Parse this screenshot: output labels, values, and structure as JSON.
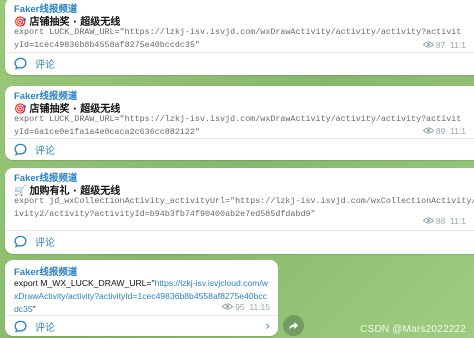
{
  "posts": [
    {
      "channel": "Faker线报频道",
      "emoji": "🎯",
      "title": "店铺抽奖 · 超级无线",
      "body": "export LUCK_DRAW_URL=\"https://lzkj-isv.isvjd.com/wxDrawActivity/activity/activity?activityId=1cec49836b8b4558af8275e40bccdc35\"",
      "views": "87",
      "time": "11:1",
      "comment_label": "评论"
    },
    {
      "channel": "Faker线报频道",
      "emoji": "🎯",
      "title": "店铺抽奖 · 超级无线",
      "body": "export LUCK_DRAW_URL=\"https://lzkj-isv.isvjd.com/wxDrawActivity/activity/activity?activityId=6a1ce0e1fa1a4e0caca2c636cc882122\"",
      "views": "89",
      "time": "11:1",
      "comment_label": "评论"
    },
    {
      "channel": "Faker线报频道",
      "emoji": "🛒",
      "title": "加购有礼 · 超级无线",
      "body": "export jd_wxCollectionActivity_activityUrl=\"https://lzkj-isv.isvjd.com/wxCollectionActivity/activity2/activity?activityId=b94b3fb74f90400ab2e7ed585dfdabd9\"",
      "views": "88",
      "time": "11:1",
      "comment_label": "评论"
    },
    {
      "channel": "Faker线报频道",
      "prefix": "export M_WX_LUCK_DRAW_URL=\"",
      "link": "https://lzkj-isv.isvjcloud.com/wxDrawActivity/activity?activityId=1cec49836b8b4558af8275e40bccdc35",
      "suffix": "\"",
      "views": "95",
      "time": "11:15",
      "comment_label": "评论"
    }
  ],
  "watermark": "CSDN @Mars2022222",
  "icons": {
    "views": "eye-icon",
    "comment": "comment-bubble-icon",
    "chevron": "chevron-right-icon",
    "share": "share-arrow-icon"
  },
  "colors": {
    "accent": "#2b83c3",
    "background": "#8fbf74"
  }
}
